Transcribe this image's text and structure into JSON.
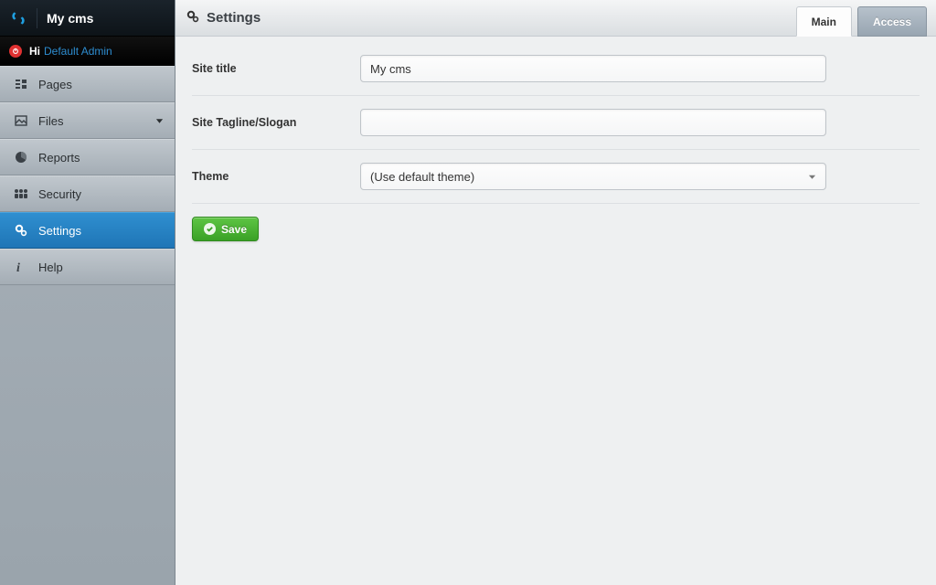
{
  "brand": {
    "title": "My cms"
  },
  "greeting": {
    "hi": "Hi",
    "user": "Default Admin"
  },
  "sidebar": {
    "items": [
      {
        "label": "Pages"
      },
      {
        "label": "Files"
      },
      {
        "label": "Reports"
      },
      {
        "label": "Security"
      },
      {
        "label": "Settings"
      },
      {
        "label": "Help"
      }
    ]
  },
  "page": {
    "title": "Settings",
    "tabs": [
      {
        "label": "Main",
        "active": true
      },
      {
        "label": "Access",
        "active": false
      }
    ]
  },
  "form": {
    "site_title": {
      "label": "Site title",
      "value": "My cms"
    },
    "tagline": {
      "label": "Site Tagline/Slogan",
      "value": ""
    },
    "theme": {
      "label": "Theme",
      "value": "(Use default theme)"
    }
  },
  "actions": {
    "save": "Save"
  }
}
